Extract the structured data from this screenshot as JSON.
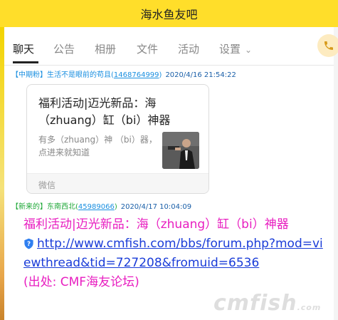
{
  "window": {
    "title": "海水鱼友吧"
  },
  "tabs": [
    {
      "label": "聊天",
      "active": true
    },
    {
      "label": "公告"
    },
    {
      "label": "相册"
    },
    {
      "label": "文件"
    },
    {
      "label": "活动"
    },
    {
      "label": "设置"
    }
  ],
  "messages": [
    {
      "tag": "【中期粉】",
      "sender": "生活不是眼前的苟且",
      "uid_open": "(",
      "uid": "1468764999",
      "uid_close": ")",
      "time": "2020/4/16 21:54:22",
      "card": {
        "title": "福利活动|迈光新品：海（zhuang）缸（bi）神器",
        "description": "有多（zhuang）神 （bi）器，点进来就知道",
        "source": "微信"
      }
    },
    {
      "tag": "【新来的】",
      "sender": "东南西北",
      "uid_open": "(",
      "uid": "45989066",
      "uid_close": ")",
      "time": "2020/4/17 10:04:09",
      "text": "福利活动|迈光新品：海（zhuang）缸（bi）神器",
      "link": "http://www.cmfish.com/bbs/forum.php?mod=viewthread&tid=727208&fromuid=6536",
      "source_note": "(出处: CMF海友论坛)"
    }
  ],
  "watermark": {
    "main": "cmfish",
    "suffix": ".com"
  },
  "colors": {
    "titlebar": "#ffde2a",
    "tag_blue": "#1a8fe0",
    "name_green": "#1fa838",
    "message_pink": "#e81ec0",
    "link_blue": "#1a3cd8"
  },
  "icons": {
    "phone": "phone-icon",
    "chevron": "chevron-down-icon",
    "shield": "shield-icon"
  }
}
